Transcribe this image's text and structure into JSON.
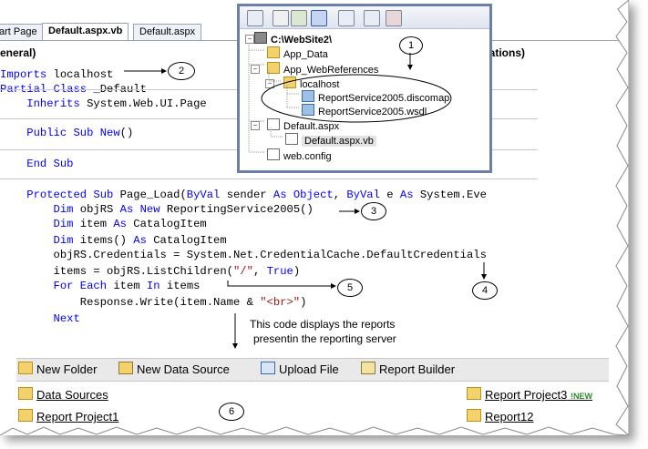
{
  "tabs": [
    "art Page",
    "Default.aspx.vb",
    "Default.aspx"
  ],
  "combo": {
    "left": "eneral)",
    "right": "rations)"
  },
  "code": [
    {
      "segs": [
        {
          "t": "Imports",
          "k": "kw"
        },
        {
          "t": " localhost",
          "k": ""
        }
      ]
    },
    {
      "segs": [
        {
          "t": "Partial Class",
          "k": "kw"
        },
        {
          "t": " _Default",
          "k": ""
        }
      ]
    },
    {
      "segs": [
        {
          "t": "    Inherits",
          "k": "kw"
        },
        {
          "t": " System.Web.UI.Page",
          "k": ""
        }
      ]
    },
    {
      "segs": [
        {
          "t": "    Public Sub New",
          "k": "kw"
        },
        {
          "t": "()",
          "k": ""
        }
      ]
    },
    {
      "segs": [
        {
          "t": "    End Sub",
          "k": "kw"
        }
      ]
    },
    {
      "segs": [
        {
          "t": "    Protected Sub",
          "k": "kw"
        },
        {
          "t": " Page_Load(",
          "k": ""
        },
        {
          "t": "ByVal",
          "k": "kw"
        },
        {
          "t": " sender ",
          "k": ""
        },
        {
          "t": "As Object",
          "k": "kw"
        },
        {
          "t": ", ",
          "k": ""
        },
        {
          "t": "ByVal",
          "k": "kw"
        },
        {
          "t": " e ",
          "k": ""
        },
        {
          "t": "As",
          "k": "kw"
        },
        {
          "t": " System.Eve",
          "k": ""
        }
      ]
    },
    {
      "segs": [
        {
          "t": "        Dim",
          "k": "kw"
        },
        {
          "t": " objRS ",
          "k": ""
        },
        {
          "t": "As New",
          "k": "kw"
        },
        {
          "t": " ReportingService2005()",
          "k": ""
        }
      ]
    },
    {
      "segs": [
        {
          "t": "        Dim",
          "k": "kw"
        },
        {
          "t": " item ",
          "k": ""
        },
        {
          "t": "As",
          "k": "kw"
        },
        {
          "t": " CatalogItem",
          "k": ""
        }
      ]
    },
    {
      "segs": [
        {
          "t": "        Dim",
          "k": "kw"
        },
        {
          "t": " items() ",
          "k": ""
        },
        {
          "t": "As",
          "k": "kw"
        },
        {
          "t": " CatalogItem",
          "k": ""
        }
      ]
    },
    {
      "segs": [
        {
          "t": "        objRS.Credentials = System.Net.CredentialCache.DefaultCredentials",
          "k": ""
        }
      ]
    },
    {
      "segs": [
        {
          "t": "        items = objRS.ListChildren(",
          "k": ""
        },
        {
          "t": "\"/\"",
          "k": "str"
        },
        {
          "t": ", ",
          "k": ""
        },
        {
          "t": "True",
          "k": "kw"
        },
        {
          "t": ")",
          "k": ""
        }
      ]
    },
    {
      "segs": [
        {
          "t": "        For Each",
          "k": "kw"
        },
        {
          "t": " item ",
          "k": ""
        },
        {
          "t": "In",
          "k": "kw"
        },
        {
          "t": " items",
          "k": ""
        }
      ]
    },
    {
      "segs": [
        {
          "t": "            Response.Write(item.Name & ",
          "k": ""
        },
        {
          "t": "\"<br>\"",
          "k": "str"
        },
        {
          "t": ")",
          "k": ""
        }
      ]
    },
    {
      "segs": [
        {
          "t": "        Next",
          "k": "kw"
        }
      ]
    }
  ],
  "solution": {
    "root": "C:\\WebSite2\\",
    "nodes": [
      "App_Data",
      "App_WebReferences",
      "localhost",
      "ReportService2005.discomap",
      "ReportService2005.wsdl",
      "Default.aspx",
      "Default.aspx.vb",
      "web.config"
    ]
  },
  "callouts": [
    "1",
    "2",
    "3",
    "4",
    "5",
    "6"
  ],
  "note": [
    "This code displays the reports",
    "presentin the reporting server"
  ],
  "report_toolbar": [
    "New Folder",
    "New Data Source",
    "Upload File",
    "Report Builder"
  ],
  "report_items": {
    "left": [
      "Data Sources",
      "Report Project1"
    ],
    "right": [
      "Report Project3",
      "Report12"
    ],
    "badge": "!NEW"
  }
}
